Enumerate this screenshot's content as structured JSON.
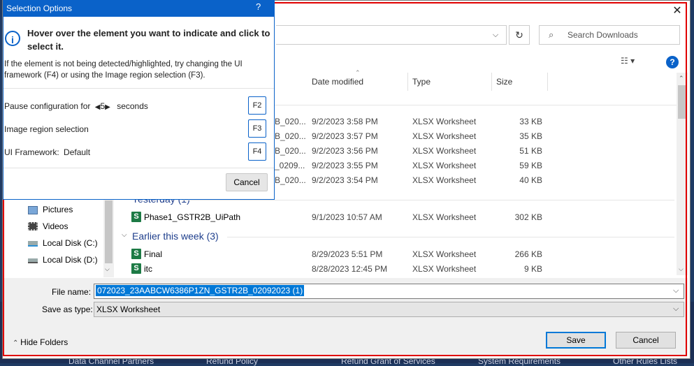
{
  "background": {
    "bottom_links": [
      "Data Channel Partners",
      "Refund Policy",
      "Refund Grant of Services",
      "System Requirements",
      "Other Rules Lists"
    ]
  },
  "toolbar": {
    "search_placeholder": "Search Downloads"
  },
  "columns": {
    "date": "Date modified",
    "type": "Type",
    "size": "Size"
  },
  "groups": {
    "yesterday": "Yesterday (1)",
    "earlier": "Earlier this week (3)"
  },
  "files_today": [
    {
      "name": "B_020...",
      "date": "9/2/2023 3:58 PM",
      "type": "XLSX Worksheet",
      "size": "33 KB"
    },
    {
      "name": "B_020...",
      "date": "9/2/2023 3:57 PM",
      "type": "XLSX Worksheet",
      "size": "35 KB"
    },
    {
      "name": "B_020...",
      "date": "9/2/2023 3:56 PM",
      "type": "XLSX Worksheet",
      "size": "51 KB"
    },
    {
      "name": "_0209...",
      "date": "9/2/2023 3:55 PM",
      "type": "XLSX Worksheet",
      "size": "59 KB"
    },
    {
      "name": "B_020...",
      "date": "9/2/2023 3:54 PM",
      "type": "XLSX Worksheet",
      "size": "40 KB"
    }
  ],
  "files_yesterday": [
    {
      "name": "Phase1_GSTR2B_UiPath",
      "date": "9/1/2023 10:57 AM",
      "type": "XLSX Worksheet",
      "size": "302 KB"
    }
  ],
  "files_earlier": [
    {
      "name": "Final",
      "date": "8/29/2023 5:51 PM",
      "type": "XLSX Worksheet",
      "size": "266 KB"
    },
    {
      "name": "itc",
      "date": "8/28/2023 12:45 PM",
      "type": "XLSX Worksheet",
      "size": "9 KB"
    }
  ],
  "nav": {
    "items": [
      {
        "label": "Pictures",
        "icon": "pictures-icon"
      },
      {
        "label": "Videos",
        "icon": "videos-icon"
      },
      {
        "label": "Local Disk (C:)",
        "icon": "drive-icon"
      },
      {
        "label": "Local Disk (D:)",
        "icon": "drive-icon"
      }
    ]
  },
  "bottom": {
    "file_name_label": "File name:",
    "file_name_value": "072023_23AABCW6386P1ZN_GSTR2B_02092023 (1)",
    "save_type_label": "Save as type:",
    "save_type_value": "XLSX Worksheet",
    "hide_folders": "Hide Folders",
    "save": "Save",
    "cancel": "Cancel"
  },
  "popup": {
    "title": "Selection Options",
    "help": "?",
    "heading": "Hover over the element you want to indicate and click to select it.",
    "description": "If the element is not being detected/highlighted, try changing the UI framework (F4) or using the Image region selection (F3).",
    "pause_prefix": "Pause configuration for",
    "pause_value": "5",
    "pause_suffix": "seconds",
    "pause_key": "F2",
    "image_region": "Image region selection",
    "image_key": "F3",
    "ui_framework": "UI Framework:",
    "ui_framework_value": "Default",
    "ui_key": "F4",
    "cancel": "Cancel"
  },
  "colors": {
    "accent": "#0a62c9",
    "selection": "#0078d7",
    "excel_green": "#1d7a45",
    "highlight_frame": "#e00000"
  }
}
